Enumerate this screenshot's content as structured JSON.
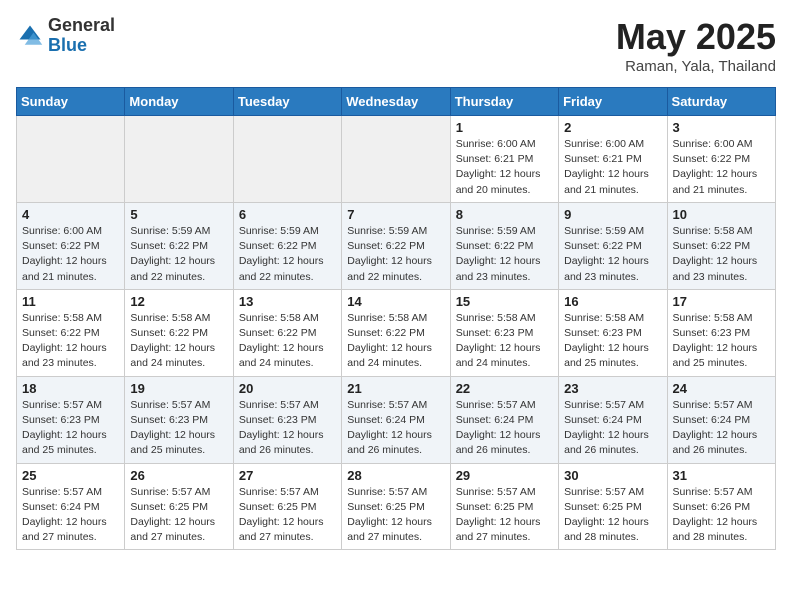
{
  "header": {
    "logo_general": "General",
    "logo_blue": "Blue",
    "month_title": "May 2025",
    "location": "Raman, Yala, Thailand"
  },
  "days_of_week": [
    "Sunday",
    "Monday",
    "Tuesday",
    "Wednesday",
    "Thursday",
    "Friday",
    "Saturday"
  ],
  "weeks": [
    [
      {
        "day": "",
        "info": ""
      },
      {
        "day": "",
        "info": ""
      },
      {
        "day": "",
        "info": ""
      },
      {
        "day": "",
        "info": ""
      },
      {
        "day": "1",
        "info": "Sunrise: 6:00 AM\nSunset: 6:21 PM\nDaylight: 12 hours\nand 20 minutes."
      },
      {
        "day": "2",
        "info": "Sunrise: 6:00 AM\nSunset: 6:21 PM\nDaylight: 12 hours\nand 21 minutes."
      },
      {
        "day": "3",
        "info": "Sunrise: 6:00 AM\nSunset: 6:22 PM\nDaylight: 12 hours\nand 21 minutes."
      }
    ],
    [
      {
        "day": "4",
        "info": "Sunrise: 6:00 AM\nSunset: 6:22 PM\nDaylight: 12 hours\nand 21 minutes."
      },
      {
        "day": "5",
        "info": "Sunrise: 5:59 AM\nSunset: 6:22 PM\nDaylight: 12 hours\nand 22 minutes."
      },
      {
        "day": "6",
        "info": "Sunrise: 5:59 AM\nSunset: 6:22 PM\nDaylight: 12 hours\nand 22 minutes."
      },
      {
        "day": "7",
        "info": "Sunrise: 5:59 AM\nSunset: 6:22 PM\nDaylight: 12 hours\nand 22 minutes."
      },
      {
        "day": "8",
        "info": "Sunrise: 5:59 AM\nSunset: 6:22 PM\nDaylight: 12 hours\nand 23 minutes."
      },
      {
        "day": "9",
        "info": "Sunrise: 5:59 AM\nSunset: 6:22 PM\nDaylight: 12 hours\nand 23 minutes."
      },
      {
        "day": "10",
        "info": "Sunrise: 5:58 AM\nSunset: 6:22 PM\nDaylight: 12 hours\nand 23 minutes."
      }
    ],
    [
      {
        "day": "11",
        "info": "Sunrise: 5:58 AM\nSunset: 6:22 PM\nDaylight: 12 hours\nand 23 minutes."
      },
      {
        "day": "12",
        "info": "Sunrise: 5:58 AM\nSunset: 6:22 PM\nDaylight: 12 hours\nand 24 minutes."
      },
      {
        "day": "13",
        "info": "Sunrise: 5:58 AM\nSunset: 6:22 PM\nDaylight: 12 hours\nand 24 minutes."
      },
      {
        "day": "14",
        "info": "Sunrise: 5:58 AM\nSunset: 6:22 PM\nDaylight: 12 hours\nand 24 minutes."
      },
      {
        "day": "15",
        "info": "Sunrise: 5:58 AM\nSunset: 6:23 PM\nDaylight: 12 hours\nand 24 minutes."
      },
      {
        "day": "16",
        "info": "Sunrise: 5:58 AM\nSunset: 6:23 PM\nDaylight: 12 hours\nand 25 minutes."
      },
      {
        "day": "17",
        "info": "Sunrise: 5:58 AM\nSunset: 6:23 PM\nDaylight: 12 hours\nand 25 minutes."
      }
    ],
    [
      {
        "day": "18",
        "info": "Sunrise: 5:57 AM\nSunset: 6:23 PM\nDaylight: 12 hours\nand 25 minutes."
      },
      {
        "day": "19",
        "info": "Sunrise: 5:57 AM\nSunset: 6:23 PM\nDaylight: 12 hours\nand 25 minutes."
      },
      {
        "day": "20",
        "info": "Sunrise: 5:57 AM\nSunset: 6:23 PM\nDaylight: 12 hours\nand 26 minutes."
      },
      {
        "day": "21",
        "info": "Sunrise: 5:57 AM\nSunset: 6:24 PM\nDaylight: 12 hours\nand 26 minutes."
      },
      {
        "day": "22",
        "info": "Sunrise: 5:57 AM\nSunset: 6:24 PM\nDaylight: 12 hours\nand 26 minutes."
      },
      {
        "day": "23",
        "info": "Sunrise: 5:57 AM\nSunset: 6:24 PM\nDaylight: 12 hours\nand 26 minutes."
      },
      {
        "day": "24",
        "info": "Sunrise: 5:57 AM\nSunset: 6:24 PM\nDaylight: 12 hours\nand 26 minutes."
      }
    ],
    [
      {
        "day": "25",
        "info": "Sunrise: 5:57 AM\nSunset: 6:24 PM\nDaylight: 12 hours\nand 27 minutes."
      },
      {
        "day": "26",
        "info": "Sunrise: 5:57 AM\nSunset: 6:25 PM\nDaylight: 12 hours\nand 27 minutes."
      },
      {
        "day": "27",
        "info": "Sunrise: 5:57 AM\nSunset: 6:25 PM\nDaylight: 12 hours\nand 27 minutes."
      },
      {
        "day": "28",
        "info": "Sunrise: 5:57 AM\nSunset: 6:25 PM\nDaylight: 12 hours\nand 27 minutes."
      },
      {
        "day": "29",
        "info": "Sunrise: 5:57 AM\nSunset: 6:25 PM\nDaylight: 12 hours\nand 27 minutes."
      },
      {
        "day": "30",
        "info": "Sunrise: 5:57 AM\nSunset: 6:25 PM\nDaylight: 12 hours\nand 28 minutes."
      },
      {
        "day": "31",
        "info": "Sunrise: 5:57 AM\nSunset: 6:26 PM\nDaylight: 12 hours\nand 28 minutes."
      }
    ]
  ]
}
